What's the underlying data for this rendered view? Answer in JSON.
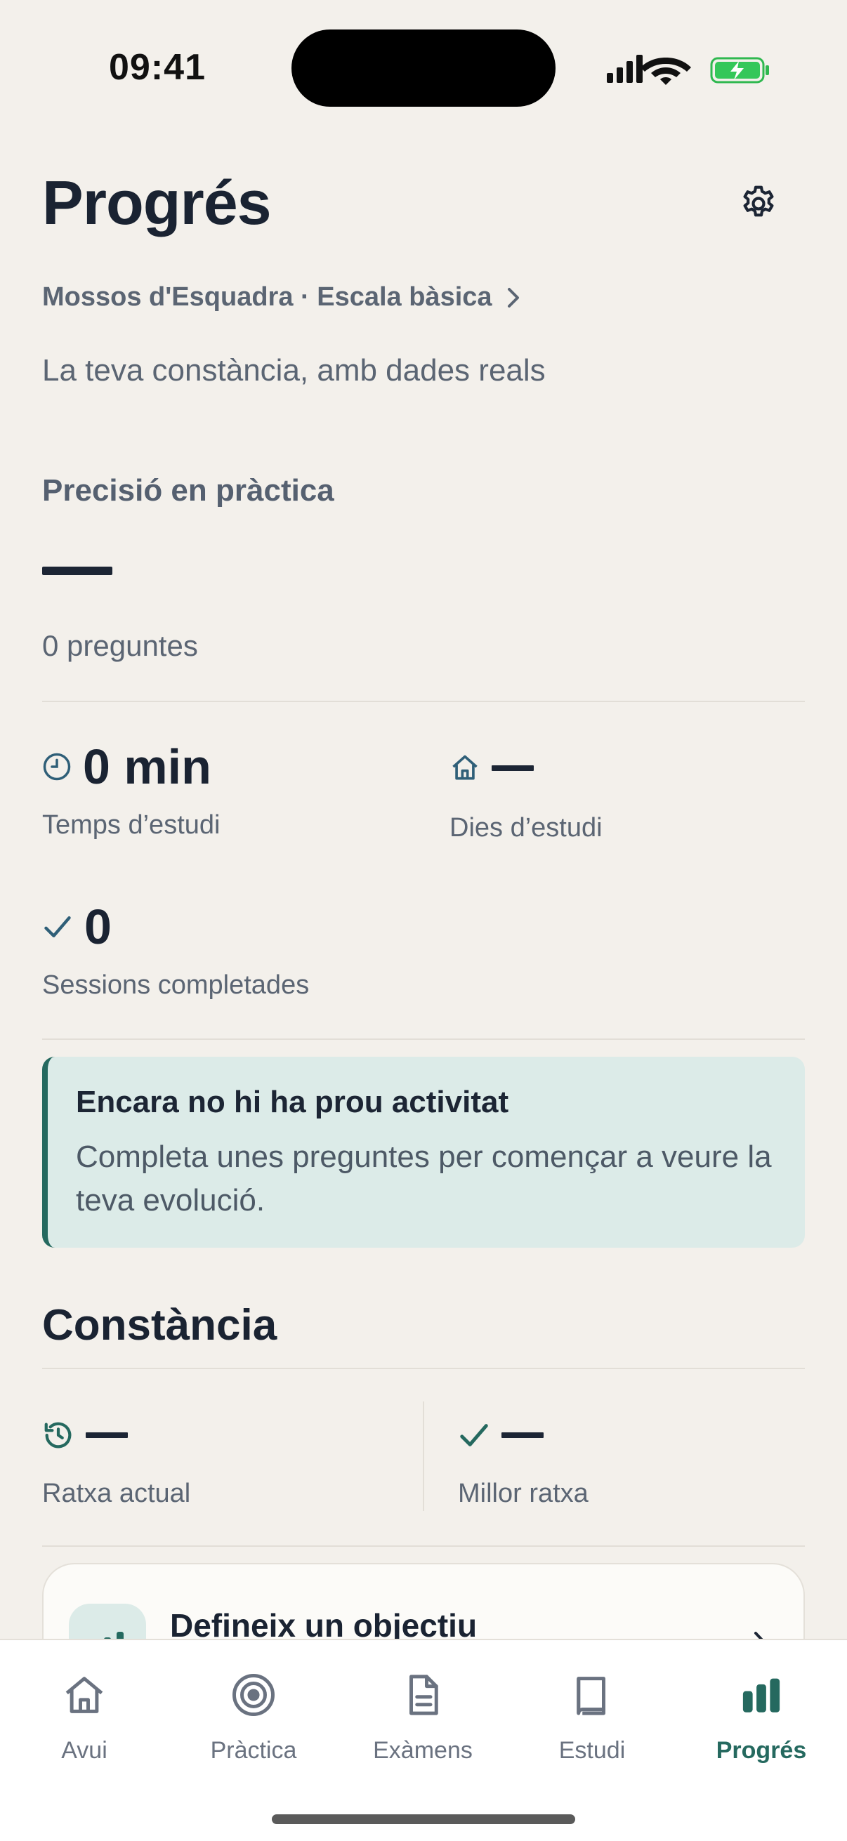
{
  "status_bar": {
    "time": "09:41"
  },
  "header": {
    "title": "Progrés",
    "breadcrumb": "Mossos d'Esquadra · Escala bàsica",
    "subtitle": "La teva constància, amb dades reals"
  },
  "precision": {
    "label": "Precisió en pràctica",
    "questions": "0 preguntes"
  },
  "stats": {
    "study_time": {
      "value": "0 min",
      "label": "Temps d’estudi",
      "icon": "clock-icon"
    },
    "study_days": {
      "label": "Dies d’estudi",
      "icon": "home-icon"
    },
    "sessions": {
      "value": "0",
      "label": "Sessions completades",
      "icon": "check-icon"
    }
  },
  "info_card": {
    "title": "Encara no hi ha prou activitat",
    "body": "Completa unes preguntes per començar a veure la teva evolució."
  },
  "constancia": {
    "title": "Constància",
    "current_streak": {
      "label": "Ratxa actual",
      "icon": "history-icon"
    },
    "best_streak": {
      "label": "Millor ratxa",
      "icon": "check-icon"
    }
  },
  "goal_card": {
    "title": "Defineix un objectiu",
    "icon": "bar-chart-icon"
  },
  "tabs": [
    {
      "label": "Avui",
      "icon": "home-icon",
      "active": false
    },
    {
      "label": "Pràctica",
      "icon": "target-icon",
      "active": false
    },
    {
      "label": "Exàmens",
      "icon": "document-icon",
      "active": false
    },
    {
      "label": "Estudi",
      "icon": "book-icon",
      "active": false
    },
    {
      "label": "Progrés",
      "icon": "bar-chart-icon",
      "active": true
    }
  ],
  "colors": {
    "background": "#f3f0eb",
    "accent": "#25695f",
    "info_bg": "#dcebe8",
    "text_primary": "#1a2332",
    "text_secondary": "#5b6573"
  }
}
